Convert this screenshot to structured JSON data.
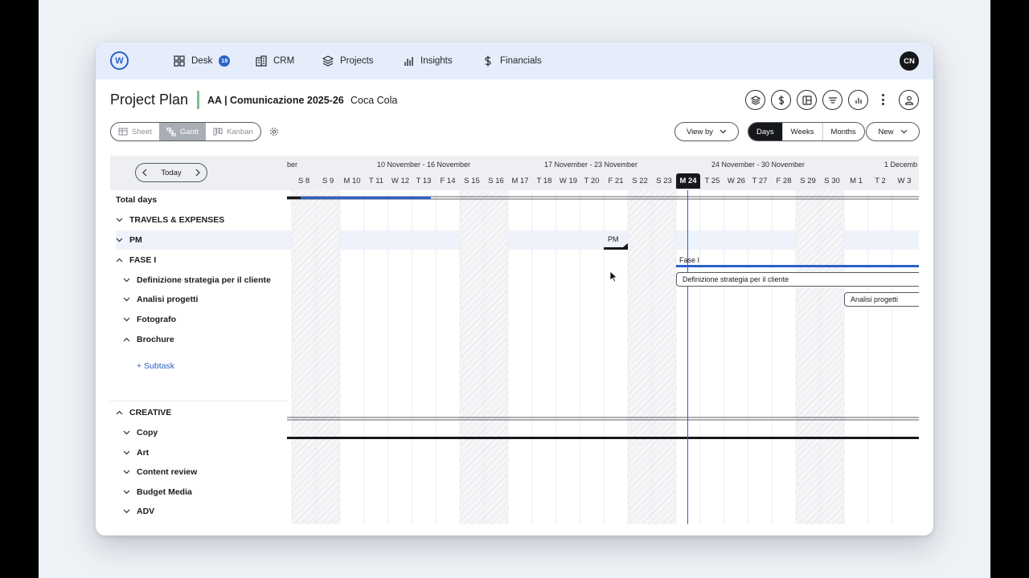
{
  "nav": {
    "logo": "W",
    "desk": "Desk",
    "desk_badge": "19",
    "crm": "CRM",
    "projects": "Projects",
    "insights": "Insights",
    "financials": "Financials",
    "avatar": "CN"
  },
  "header": {
    "title": "Project Plan",
    "project": "AA | Comunicazione 2025-26",
    "client": "Coca Cola"
  },
  "toolbar": {
    "views": [
      "Sheet",
      "Gantt",
      "Kanban"
    ],
    "active_view": "Gantt",
    "view_by": "View by",
    "scales": [
      "Days",
      "Weeks",
      "Months"
    ],
    "active_scale": "Days",
    "new": "New"
  },
  "gantt": {
    "today_label": "Today",
    "weeks": [
      "ber",
      "10 November - 16 November",
      "17 November - 23 November",
      "24 November - 30 November",
      "1 Decemb"
    ],
    "days": [
      "S 8",
      "S 9",
      "M 10",
      "T 11",
      "W 12",
      "T 13",
      "F 14",
      "S 15",
      "S 16",
      "M 17",
      "T 18",
      "W 19",
      "T 20",
      "F 21",
      "S 22",
      "S 23",
      "M 24",
      "T 25",
      "W 26",
      "T 27",
      "F 28",
      "S 29",
      "S 30",
      "M 1",
      "T 2",
      "W 3"
    ],
    "rows": {
      "total": "Total days",
      "travels": "TRAVELS & EXPENSES",
      "pm": "PM",
      "fase": "FASE I",
      "def": "Definizione strategia per il cliente",
      "analisi": "Analisi progetti",
      "foto": "Fotografo",
      "brochure": "Brochure",
      "subtask": "+ Subtask",
      "creative": "CREATIVE",
      "copy": "Copy",
      "art": "Art",
      "content": "Content review",
      "budget": "Budget Media",
      "adv": "ADV"
    },
    "bars": {
      "pm": "PM",
      "fase": "Fase I",
      "def": "Definizione strategia per il cliente",
      "analisi": "Analisi progetti"
    }
  }
}
